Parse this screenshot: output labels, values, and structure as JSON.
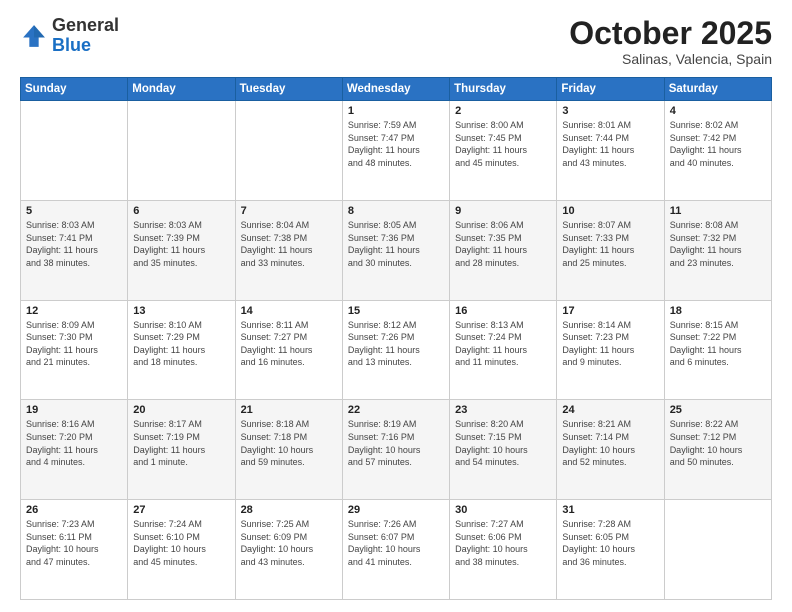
{
  "header": {
    "logo_general": "General",
    "logo_blue": "Blue",
    "month": "October 2025",
    "location": "Salinas, Valencia, Spain"
  },
  "weekdays": [
    "Sunday",
    "Monday",
    "Tuesday",
    "Wednesday",
    "Thursday",
    "Friday",
    "Saturday"
  ],
  "weeks": [
    [
      {
        "day": "",
        "info": ""
      },
      {
        "day": "",
        "info": ""
      },
      {
        "day": "",
        "info": ""
      },
      {
        "day": "1",
        "info": "Sunrise: 7:59 AM\nSunset: 7:47 PM\nDaylight: 11 hours\nand 48 minutes."
      },
      {
        "day": "2",
        "info": "Sunrise: 8:00 AM\nSunset: 7:45 PM\nDaylight: 11 hours\nand 45 minutes."
      },
      {
        "day": "3",
        "info": "Sunrise: 8:01 AM\nSunset: 7:44 PM\nDaylight: 11 hours\nand 43 minutes."
      },
      {
        "day": "4",
        "info": "Sunrise: 8:02 AM\nSunset: 7:42 PM\nDaylight: 11 hours\nand 40 minutes."
      }
    ],
    [
      {
        "day": "5",
        "info": "Sunrise: 8:03 AM\nSunset: 7:41 PM\nDaylight: 11 hours\nand 38 minutes."
      },
      {
        "day": "6",
        "info": "Sunrise: 8:03 AM\nSunset: 7:39 PM\nDaylight: 11 hours\nand 35 minutes."
      },
      {
        "day": "7",
        "info": "Sunrise: 8:04 AM\nSunset: 7:38 PM\nDaylight: 11 hours\nand 33 minutes."
      },
      {
        "day": "8",
        "info": "Sunrise: 8:05 AM\nSunset: 7:36 PM\nDaylight: 11 hours\nand 30 minutes."
      },
      {
        "day": "9",
        "info": "Sunrise: 8:06 AM\nSunset: 7:35 PM\nDaylight: 11 hours\nand 28 minutes."
      },
      {
        "day": "10",
        "info": "Sunrise: 8:07 AM\nSunset: 7:33 PM\nDaylight: 11 hours\nand 25 minutes."
      },
      {
        "day": "11",
        "info": "Sunrise: 8:08 AM\nSunset: 7:32 PM\nDaylight: 11 hours\nand 23 minutes."
      }
    ],
    [
      {
        "day": "12",
        "info": "Sunrise: 8:09 AM\nSunset: 7:30 PM\nDaylight: 11 hours\nand 21 minutes."
      },
      {
        "day": "13",
        "info": "Sunrise: 8:10 AM\nSunset: 7:29 PM\nDaylight: 11 hours\nand 18 minutes."
      },
      {
        "day": "14",
        "info": "Sunrise: 8:11 AM\nSunset: 7:27 PM\nDaylight: 11 hours\nand 16 minutes."
      },
      {
        "day": "15",
        "info": "Sunrise: 8:12 AM\nSunset: 7:26 PM\nDaylight: 11 hours\nand 13 minutes."
      },
      {
        "day": "16",
        "info": "Sunrise: 8:13 AM\nSunset: 7:24 PM\nDaylight: 11 hours\nand 11 minutes."
      },
      {
        "day": "17",
        "info": "Sunrise: 8:14 AM\nSunset: 7:23 PM\nDaylight: 11 hours\nand 9 minutes."
      },
      {
        "day": "18",
        "info": "Sunrise: 8:15 AM\nSunset: 7:22 PM\nDaylight: 11 hours\nand 6 minutes."
      }
    ],
    [
      {
        "day": "19",
        "info": "Sunrise: 8:16 AM\nSunset: 7:20 PM\nDaylight: 11 hours\nand 4 minutes."
      },
      {
        "day": "20",
        "info": "Sunrise: 8:17 AM\nSunset: 7:19 PM\nDaylight: 11 hours\nand 1 minute."
      },
      {
        "day": "21",
        "info": "Sunrise: 8:18 AM\nSunset: 7:18 PM\nDaylight: 10 hours\nand 59 minutes."
      },
      {
        "day": "22",
        "info": "Sunrise: 8:19 AM\nSunset: 7:16 PM\nDaylight: 10 hours\nand 57 minutes."
      },
      {
        "day": "23",
        "info": "Sunrise: 8:20 AM\nSunset: 7:15 PM\nDaylight: 10 hours\nand 54 minutes."
      },
      {
        "day": "24",
        "info": "Sunrise: 8:21 AM\nSunset: 7:14 PM\nDaylight: 10 hours\nand 52 minutes."
      },
      {
        "day": "25",
        "info": "Sunrise: 8:22 AM\nSunset: 7:12 PM\nDaylight: 10 hours\nand 50 minutes."
      }
    ],
    [
      {
        "day": "26",
        "info": "Sunrise: 7:23 AM\nSunset: 6:11 PM\nDaylight: 10 hours\nand 47 minutes."
      },
      {
        "day": "27",
        "info": "Sunrise: 7:24 AM\nSunset: 6:10 PM\nDaylight: 10 hours\nand 45 minutes."
      },
      {
        "day": "28",
        "info": "Sunrise: 7:25 AM\nSunset: 6:09 PM\nDaylight: 10 hours\nand 43 minutes."
      },
      {
        "day": "29",
        "info": "Sunrise: 7:26 AM\nSunset: 6:07 PM\nDaylight: 10 hours\nand 41 minutes."
      },
      {
        "day": "30",
        "info": "Sunrise: 7:27 AM\nSunset: 6:06 PM\nDaylight: 10 hours\nand 38 minutes."
      },
      {
        "day": "31",
        "info": "Sunrise: 7:28 AM\nSunset: 6:05 PM\nDaylight: 10 hours\nand 36 minutes."
      },
      {
        "day": "",
        "info": ""
      }
    ]
  ]
}
